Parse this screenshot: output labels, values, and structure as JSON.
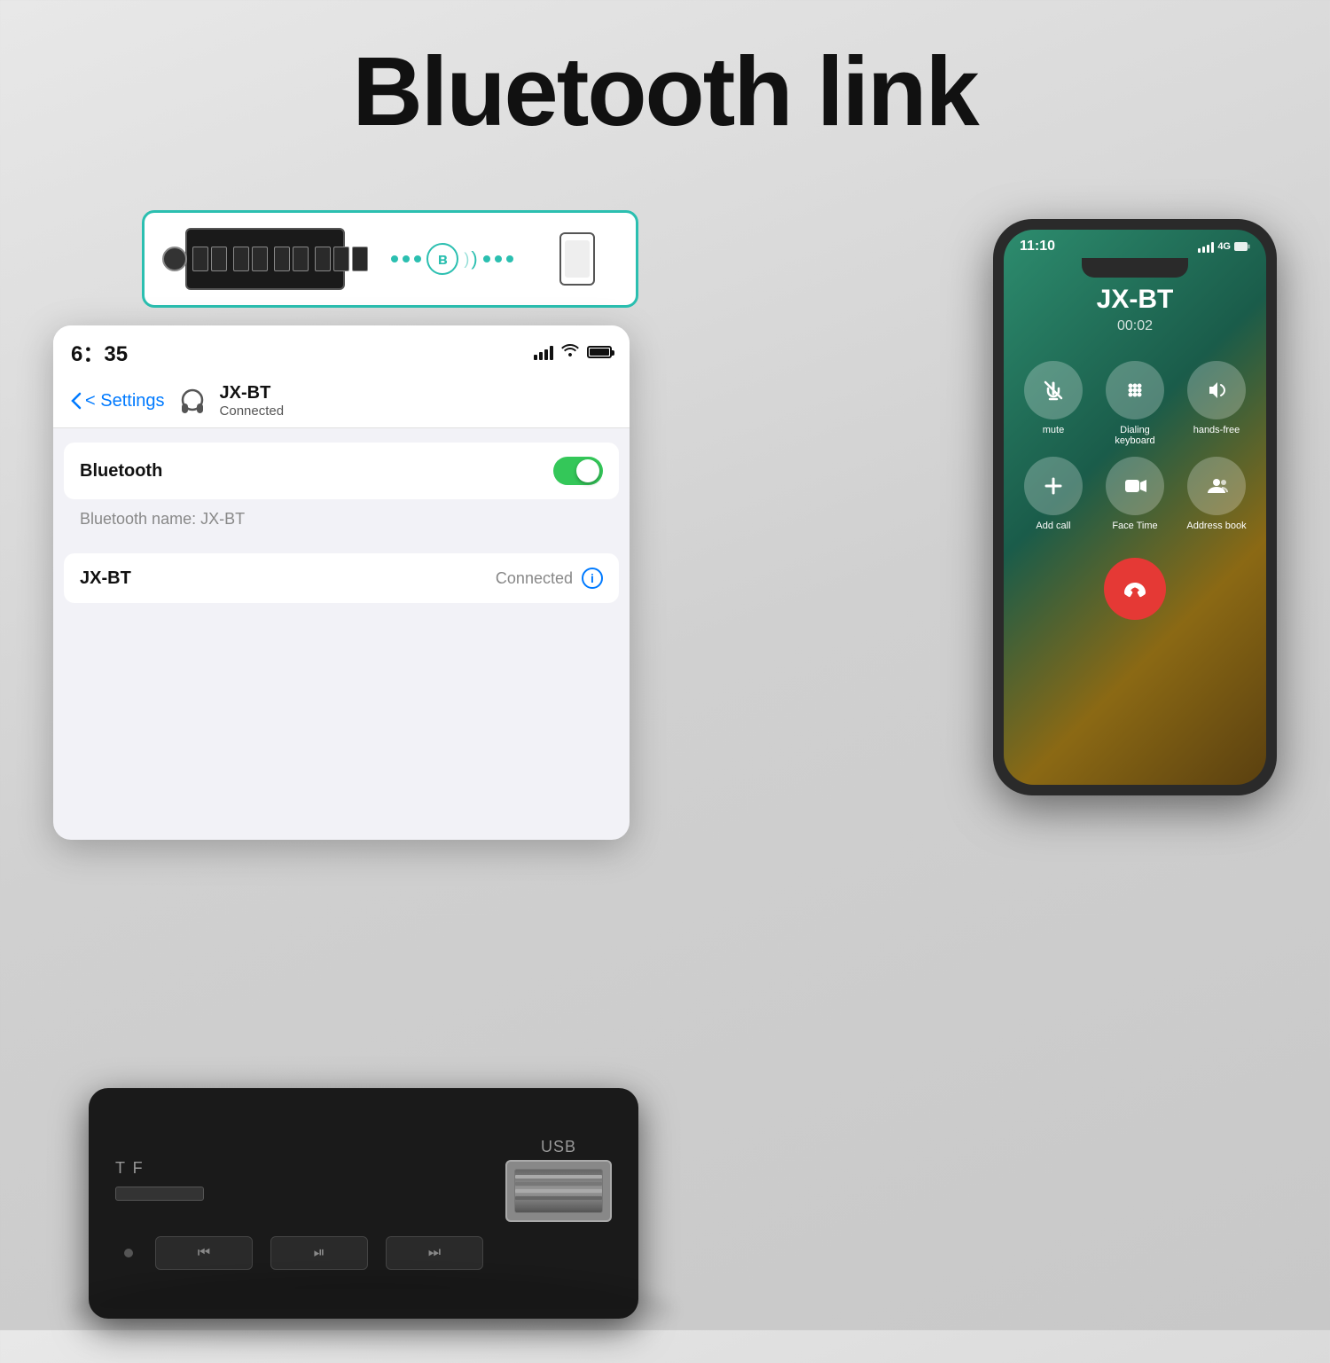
{
  "page": {
    "title": "Bluetooth link",
    "background": "#d8d8d8"
  },
  "device_panel": {
    "border_color": "#2bbfb0"
  },
  "ios_settings": {
    "time": "6：35",
    "nav_back": "< Settings",
    "device_name": "JX-BT",
    "device_status": "Connected",
    "bluetooth_label": "Bluetooth",
    "toggle_on": true,
    "bt_name_label": "Bluetooth name: JX-BT",
    "device_row_name": "JX-BT",
    "device_row_status": "Connected"
  },
  "smartphone": {
    "time": "11:10",
    "call_name": "JX-BT",
    "call_duration": "00:02",
    "buttons": [
      {
        "label": "mute",
        "icon": "🎤"
      },
      {
        "label": "Dialing keyboard",
        "icon": "⌨️"
      },
      {
        "label": "hands-free",
        "icon": "🔊"
      },
      {
        "label": "Add call",
        "icon": "+"
      },
      {
        "label": "Face Time",
        "icon": "📹"
      },
      {
        "label": "Address book",
        "icon": "👥"
      }
    ]
  },
  "device_bottom": {
    "tf_label": "T  F",
    "usb_label": "USB"
  }
}
